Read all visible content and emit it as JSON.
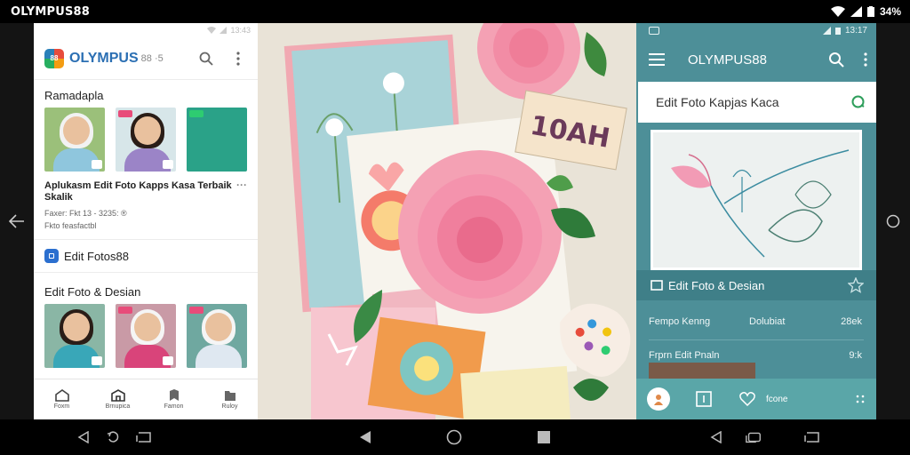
{
  "statusbar": {
    "title": "OLYMPUS88",
    "battery": "34%"
  },
  "left_panel": {
    "status": "13:43",
    "app_name": "OLYMPUS",
    "app_name_suffix": "88 ·5",
    "section1_title": "Ramadapla",
    "post_title": "Aplukasm Edit Foto Kapps Kasa Terbaik Skalik",
    "post_meta_line1": "Faxer: Fkt 13 - 3235: ®",
    "post_meta_line2": "Fkto feasfactbl",
    "row_label": "Edit Fotos88",
    "section2_title": "Edit Foto & Desian",
    "tabs": [
      {
        "label": "Foxm"
      },
      {
        "label": "Brnupica"
      },
      {
        "label": "Famon"
      },
      {
        "label": "Ruloy"
      }
    ]
  },
  "right_panel": {
    "status": "13:17",
    "title": "OLYMPUS88",
    "search_value": "Edit Foto Kapjas Kaca",
    "bar_label": "Edit Foto & Desian",
    "rows": [
      {
        "c1": "Fempo Kenng",
        "c2": "Dolubiat",
        "c3": "28ek"
      },
      {
        "c1": "Frprn Edit Pnaln",
        "c2": "",
        "c3": "9:k"
      }
    ],
    "bottom_text": "fcone"
  },
  "collage": {
    "label_text": "10AH"
  },
  "colors": {
    "teal": "#4d8f98",
    "brand_blue": "#2b6fb3",
    "rose": "#f4a1b4"
  }
}
